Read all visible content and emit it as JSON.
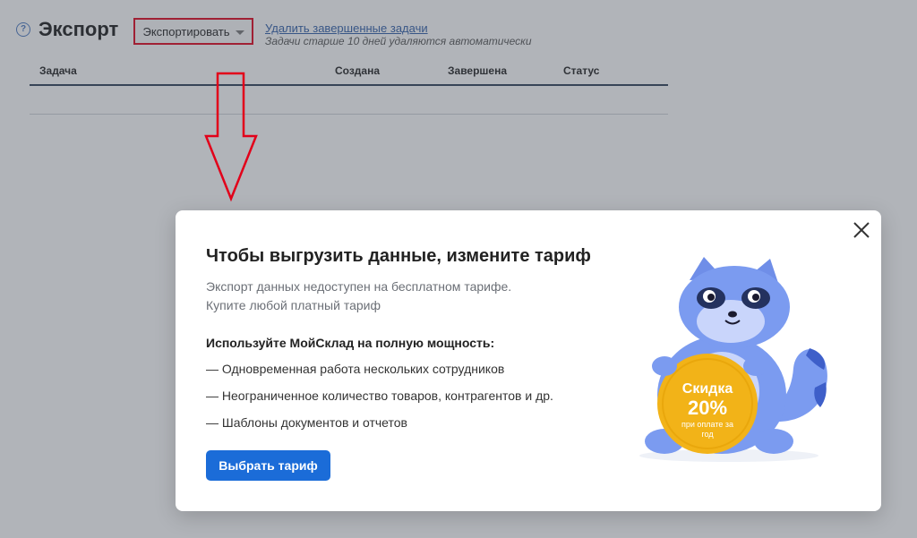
{
  "header": {
    "title": "Экспорт",
    "help_icon": "?",
    "export_button_label": "Экспортировать",
    "delete_link": "Удалить завершенные задачи",
    "delete_note": "Задачи старше 10 дней удаляются автоматически"
  },
  "table": {
    "columns": [
      "Задача",
      "Создана",
      "Завершена",
      "Статус"
    ]
  },
  "modal": {
    "title": "Чтобы выгрузить данные, измените тариф",
    "subtitle_lines": [
      "Экспорт данных недоступен на бесплатном тарифе.",
      "Купите любой платный тариф"
    ],
    "features_heading": "Используйте МойСклад на полную мощность:",
    "features": [
      "— Одновременная работа нескольких сотрудников",
      "— Неограниченное количество товаров, контрагентов и др.",
      "— Шаблоны документов и отчетов"
    ],
    "cta_label": "Выбрать тариф",
    "badge": {
      "title": "Скидка",
      "value": "20%",
      "line1": "при оплате за",
      "line2": "год"
    }
  },
  "colors": {
    "accent": "#1b6cd8",
    "highlight": "#e2001a",
    "badge": "#f2b318",
    "mascot": "#7b9bf0"
  }
}
